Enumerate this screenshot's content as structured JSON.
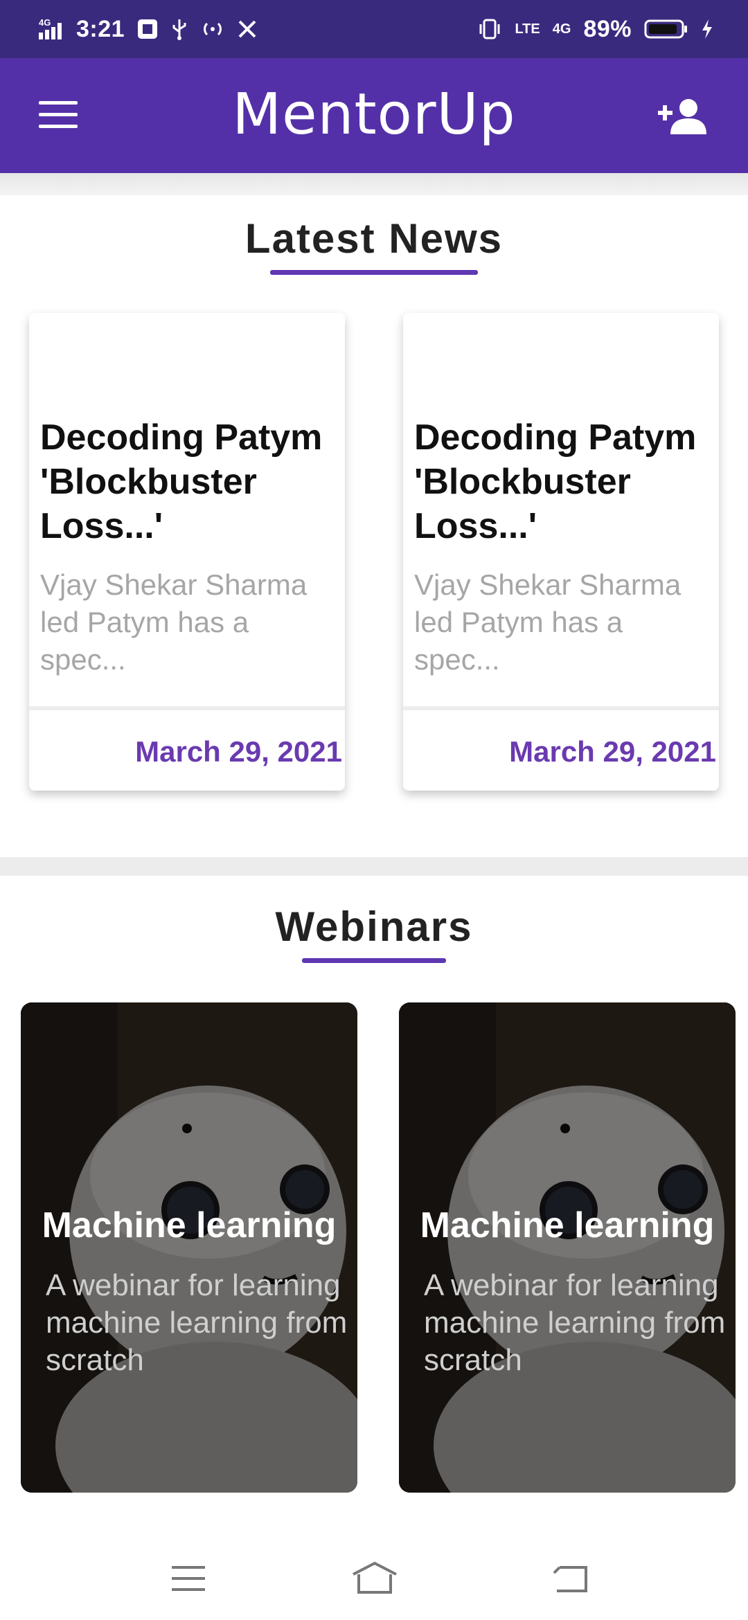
{
  "status_bar": {
    "network_left": "4G",
    "time": "3:21",
    "lte_label": "LTE",
    "network_right": "4G",
    "battery": "89%"
  },
  "app_bar": {
    "title": "MentorUp",
    "menu_icon": "hamburger-menu-icon",
    "add_user_icon": "person-add-icon"
  },
  "latest_news": {
    "title": "Latest News",
    "cards": [
      {
        "headline": "Decoding Patym 'Blockbuster Loss...'",
        "summary": "Vjay Shekar Sharma led Patym has a spec...",
        "date": "March 29, 2021"
      },
      {
        "headline": "Decoding Patym 'Blockbuster Loss...'",
        "summary": "Vjay Shekar Sharma led Patym has a spec...",
        "date": "March 29, 2021"
      }
    ]
  },
  "webinars": {
    "title": "Webinars",
    "cards": [
      {
        "title": "Machine learning",
        "description": "A webinar for learning machine learning from scratch"
      },
      {
        "title": "Machine learning",
        "description": "A webinar for learning machine learning from scratch"
      }
    ]
  },
  "nav_bar": {
    "icons": [
      "recent-apps-icon",
      "home-icon",
      "back-icon"
    ]
  },
  "colors": {
    "status_bar": "#3a2a7e",
    "app_bar": "#5430a8",
    "accent": "#5f37b3",
    "date_text": "#6a3ab0"
  }
}
